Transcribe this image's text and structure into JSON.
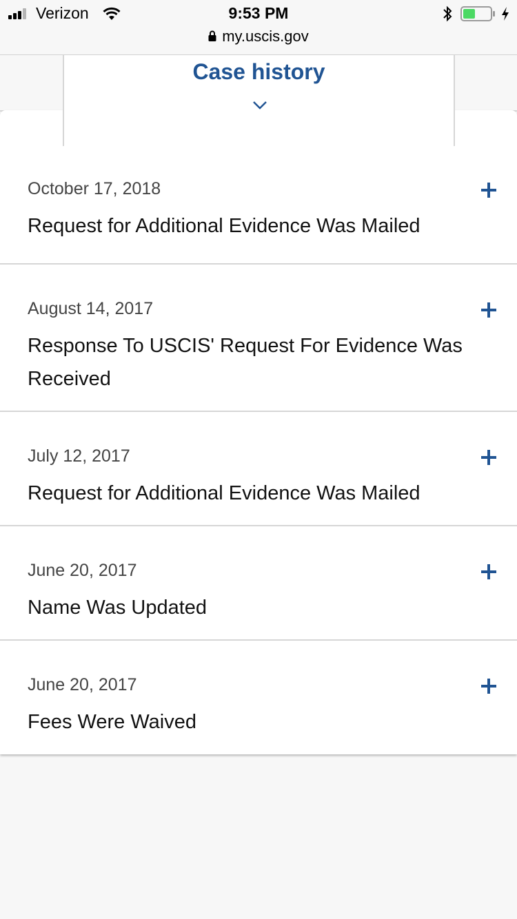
{
  "status_bar": {
    "carrier": "Verizon",
    "time": "9:53 PM",
    "url": "my.uscis.gov"
  },
  "tab": {
    "title": "Case history"
  },
  "history": [
    {
      "date": "October 17, 2018",
      "title": "Request for Additional Evidence Was Mailed"
    },
    {
      "date": "August 14, 2017",
      "title": "Response To USCIS' Request For Evidence Was Received"
    },
    {
      "date": "July 12, 2017",
      "title": "Request for Additional Evidence Was Mailed"
    },
    {
      "date": "June 20, 2017",
      "title": "Name Was Updated"
    },
    {
      "date": "June 20, 2017",
      "title": "Fees Were Waived"
    }
  ],
  "colors": {
    "accent": "#205493",
    "battery_fill": "#4cd964"
  }
}
